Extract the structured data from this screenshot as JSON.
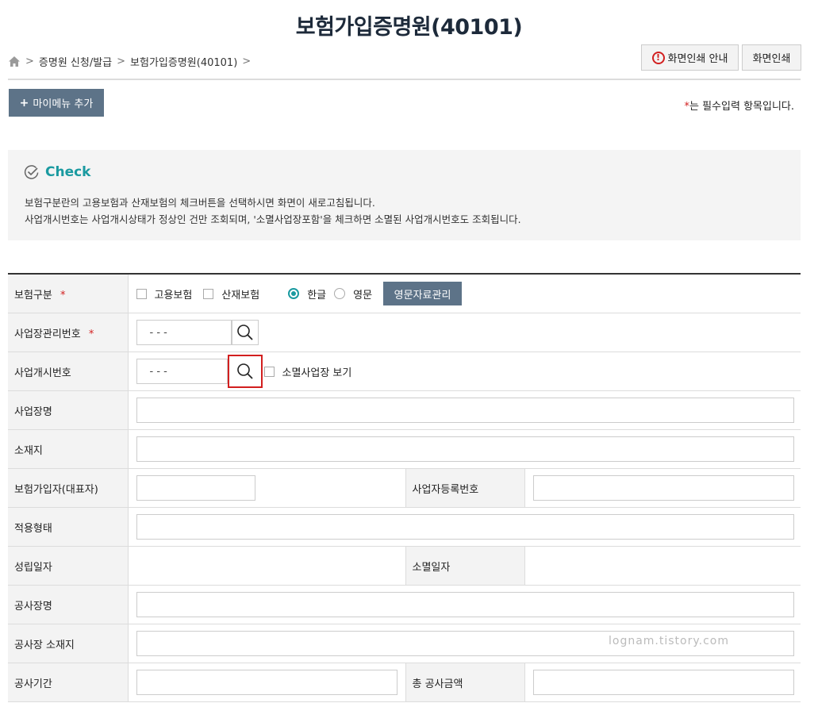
{
  "page": {
    "title": "보험가입증명원(40101)"
  },
  "breadcrumb": {
    "item1": "증명원 신청/발급",
    "item2": "보험가입증명원(40101)"
  },
  "buttons": {
    "print_guide": "화면인쇄 안내",
    "print": "화면인쇄",
    "add_mymenu": "마이메뉴 추가",
    "eng_data": "영문자료관리"
  },
  "required_note": {
    "star": "*",
    "text": "는 필수입력 항목입니다."
  },
  "check": {
    "title": "Check",
    "line1": "보험구분란의 고용보험과 산재보험의 체크버튼을 선택하시면 화면이 새로고침됩니다.",
    "line2": "사업개시번호는 사업개시상태가 정상인 건만 조회되며, '소멸사업장포함'을 체크하면 소멸된 사업개시번호도 조회됩니다."
  },
  "form": {
    "insurance_type": {
      "label": "보험구분",
      "opt_employment": "고용보험",
      "opt_industrial": "산재보험",
      "opt_korean": "한글",
      "opt_english": "영문"
    },
    "workplace_mgmt_no": {
      "label": "사업장관리번호",
      "value": "- -   -"
    },
    "business_start_no": {
      "label": "사업개시번호",
      "value": "- -   -",
      "closed_label": "소멸사업장 보기"
    },
    "workplace_name": {
      "label": "사업장명"
    },
    "location": {
      "label": "소재지"
    },
    "insured_rep": {
      "label": "보험가입자(대표자)"
    },
    "biz_reg_no": {
      "label": "사업자등록번호"
    },
    "apply_type": {
      "label": "적용형태"
    },
    "established_date": {
      "label": "성립일자"
    },
    "closed_date": {
      "label": "소멸일자"
    },
    "construction_name": {
      "label": "공사장명"
    },
    "construction_location": {
      "label": "공사장 소재지"
    },
    "construction_period": {
      "label": "공사기간"
    },
    "total_amount": {
      "label": "총 공사금액"
    }
  },
  "watermark": "lognam.tistory.com",
  "colors": {
    "accent": "#1a9aa0",
    "button_bg": "#5d7388",
    "required": "#d21f1f",
    "title": "#1d2a3a"
  },
  "icons": {
    "home": "home-icon",
    "warning": "warning-icon",
    "check": "check-circle-icon",
    "search": "search-icon"
  }
}
